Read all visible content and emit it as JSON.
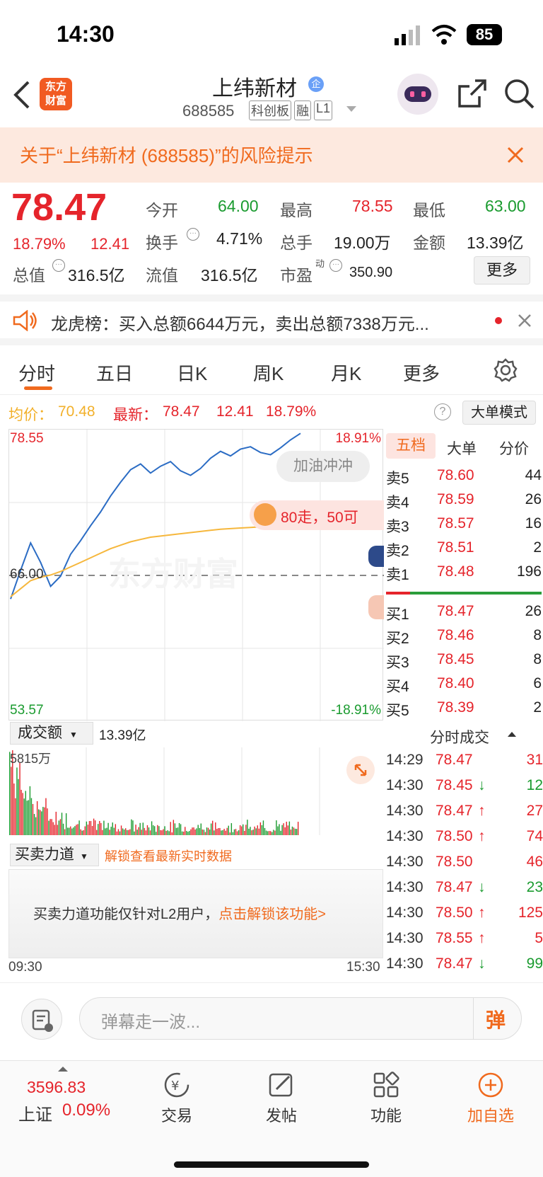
{
  "status": {
    "time": "14:30",
    "battery": "85"
  },
  "header": {
    "app_logo_line1": "东方",
    "app_logo_line2": "财富",
    "stock_name": "上纬新材",
    "company_badge": "企",
    "code": "688585",
    "tags": [
      "科创板",
      "融",
      "L1"
    ]
  },
  "risk": {
    "text": "关于“上纬新材 (688585)”的风险提示"
  },
  "quote": {
    "price": "78.47",
    "change_pct": "18.79%",
    "change": "12.41",
    "open_label": "今开",
    "open": "64.00",
    "high_label": "最高",
    "high": "78.55",
    "low_label": "最低",
    "low": "63.00",
    "turnover_label": "换手",
    "turnover": "4.71%",
    "volume_label": "总手",
    "volume": "19.00万",
    "amount_label": "金额",
    "amount": "13.39亿",
    "mktcap_label": "总值",
    "mktcap": "316.5亿",
    "float_label": "流值",
    "float": "316.5亿",
    "pe_label": "市盈",
    "pe_sup": "动",
    "pe": "350.90",
    "more_button": "更多"
  },
  "lhb": {
    "text": "龙虎榜：买入总额6644万元，卖出总额7338万元..."
  },
  "tabs": [
    "分时",
    "五日",
    "日K",
    "周K",
    "月K",
    "更多"
  ],
  "info": {
    "avg_label": "均价：",
    "avg": "70.48",
    "latest_label": "最新：",
    "latest": "78.47",
    "latest_change": "12.41",
    "latest_pct": "18.79%",
    "mode_button": "大单模式"
  },
  "chart": {
    "y_top": "78.55",
    "y_mid": "66.00",
    "y_bot": "53.57",
    "pct_top": "18.91%",
    "pct_bot": "-18.91%",
    "bubble1": "加油冲冲",
    "bubble2": "80走，50可",
    "watermark": "东方财富",
    "x_start": "09:30",
    "x_end": "15:30"
  },
  "chart_data": {
    "type": "line",
    "title": "",
    "ylim": [
      53.57,
      78.55
    ],
    "reference": 66.0,
    "series": [
      {
        "name": "最新",
        "values": [
          64.0,
          66.5,
          68.9,
          67.2,
          65.1,
          66.0,
          67.9,
          69.1,
          70.4,
          71.6,
          73.0,
          74.2,
          75.3,
          75.8,
          75.0,
          75.6,
          76.0,
          75.2,
          74.8,
          75.4,
          76.3,
          76.9,
          76.5,
          77.1,
          77.3,
          76.8,
          76.6,
          77.2,
          77.9,
          78.47
        ]
      },
      {
        "name": "均价",
        "values": [
          64.2,
          64.9,
          65.6,
          65.9,
          66.1,
          66.4,
          66.8,
          67.2,
          67.6,
          68.0,
          68.4,
          68.7,
          69.0,
          69.2,
          69.4,
          69.5,
          69.6,
          69.7,
          69.8,
          69.9,
          70.0,
          70.1,
          70.15,
          70.2,
          70.25,
          70.3,
          70.35,
          70.4,
          70.45,
          70.48
        ]
      }
    ]
  },
  "book": {
    "tabs": [
      "五档",
      "大单",
      "分价"
    ],
    "asks": [
      {
        "label": "卖5",
        "price": "78.60",
        "vol": "44"
      },
      {
        "label": "卖4",
        "price": "78.59",
        "vol": "26"
      },
      {
        "label": "卖3",
        "price": "78.57",
        "vol": "16"
      },
      {
        "label": "卖2",
        "price": "78.51",
        "vol": "2"
      },
      {
        "label": "卖1",
        "price": "78.48",
        "vol": "196"
      }
    ],
    "bids": [
      {
        "label": "买1",
        "price": "78.47",
        "vol": "26"
      },
      {
        "label": "买2",
        "price": "78.46",
        "vol": "8"
      },
      {
        "label": "买3",
        "price": "78.45",
        "vol": "8"
      },
      {
        "label": "买4",
        "price": "78.40",
        "vol": "6"
      },
      {
        "label": "买5",
        "price": "78.39",
        "vol": "2"
      }
    ]
  },
  "volume": {
    "selector": "成交额",
    "total": "13.39亿",
    "max_label": "5815万"
  },
  "force": {
    "selector": "买卖力道",
    "unlock_hint": "解锁查看最新实时数据",
    "msg": "买卖力道功能仅针对L2用户，",
    "link": "点击解锁该功能>"
  },
  "trades": {
    "header": "分时成交",
    "rows": [
      {
        "time": "14:29",
        "price": "78.47",
        "arrow": "",
        "vol": "31",
        "dir": "red"
      },
      {
        "time": "14:30",
        "price": "78.45",
        "arrow": "↓",
        "vol": "12",
        "dir": "green"
      },
      {
        "time": "14:30",
        "price": "78.47",
        "arrow": "↑",
        "vol": "27",
        "dir": "red"
      },
      {
        "time": "14:30",
        "price": "78.50",
        "arrow": "↑",
        "vol": "74",
        "dir": "red"
      },
      {
        "time": "14:30",
        "price": "78.50",
        "arrow": "",
        "vol": "46",
        "dir": "red"
      },
      {
        "time": "14:30",
        "price": "78.47",
        "arrow": "↓",
        "vol": "23",
        "dir": "green"
      },
      {
        "time": "14:30",
        "price": "78.50",
        "arrow": "↑",
        "vol": "125",
        "dir": "red"
      },
      {
        "time": "14:30",
        "price": "78.55",
        "arrow": "↑",
        "vol": "5",
        "dir": "red"
      },
      {
        "time": "14:30",
        "price": "78.47",
        "arrow": "↓",
        "vol": "99",
        "dir": "green"
      }
    ]
  },
  "danmu": {
    "placeholder": "弹幕走一波...",
    "button": "弹"
  },
  "bottom": {
    "index_value": "3596.83",
    "index_name": "上证",
    "index_pct": "0.09%",
    "nav": [
      "交易",
      "发帖",
      "功能",
      "加自选"
    ]
  }
}
